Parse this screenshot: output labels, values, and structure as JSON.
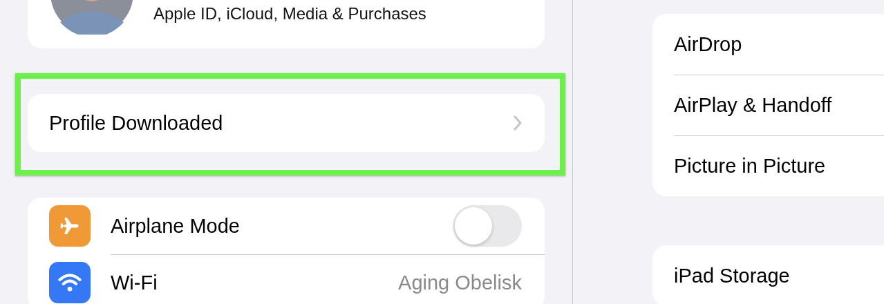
{
  "account": {
    "subtitle": "Apple ID, iCloud, Media & Purchases"
  },
  "profile": {
    "label": "Profile Downloaded",
    "highlighted": true
  },
  "settings": [
    {
      "kind": "toggle",
      "label": "Airplane Mode",
      "on": false,
      "color": "#f09a37"
    },
    {
      "kind": "value",
      "label": "Wi-Fi",
      "value": "Aging Obelisk",
      "color": "#3478f6"
    }
  ],
  "detail_groups": [
    [
      {
        "label": "AirDrop"
      },
      {
        "label": "AirPlay & Handoff"
      },
      {
        "label": "Picture in Picture"
      }
    ],
    [
      {
        "label": "iPad Storage"
      }
    ]
  ]
}
